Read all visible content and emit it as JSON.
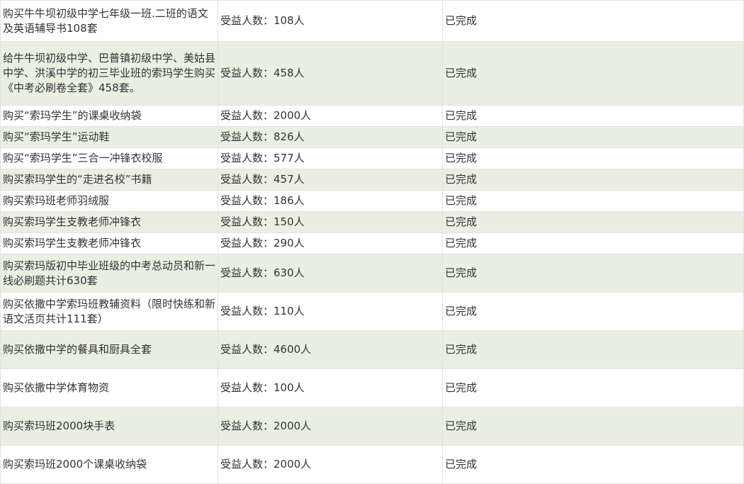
{
  "table": {
    "rows": [
      {
        "item": "购买牛牛坝初级中学七年级一班.二班的语文及英语辅导书108套",
        "beneficiaries": "受益人数：108人",
        "status": "已完成"
      },
      {
        "item": "给牛牛坝初级中学、巴普镇初级中学、美姑县中学、洪溪中学的初三毕业班的索玛学生购买《中考必刷卷全套》458套。",
        "beneficiaries": "受益人数：458人",
        "status": "已完成"
      },
      {
        "item": "购买“索玛学生”的课桌收纳袋",
        "beneficiaries": "受益人数：2000人",
        "status": "已完成"
      },
      {
        "item": "购买“索玛学生”运动鞋",
        "beneficiaries": "受益人数：826人",
        "status": "已完成"
      },
      {
        "item": "购买“索玛学生”三合一冲锋衣校服",
        "beneficiaries": "受益人数：577人",
        "status": "已完成"
      },
      {
        "item": "购买索玛学生的“走进名校”书籍",
        "beneficiaries": "受益人数：457人",
        "status": "已完成"
      },
      {
        "item": "购买索玛班老师羽绒服",
        "beneficiaries": "受益人数：186人",
        "status": "已完成"
      },
      {
        "item": "购买索玛学生支教老师冲锋衣",
        "beneficiaries": "受益人数：150人",
        "status": "已完成"
      },
      {
        "item": "购买索玛学生支教老师冲锋衣",
        "beneficiaries": "受益人数：290人",
        "status": "已完成"
      },
      {
        "item": "购买索玛版初中毕业班级的中考总动员和新一线必刷题共计630套",
        "beneficiaries": "受益人数：630人",
        "status": "已完成"
      },
      {
        "item": "购买依撒中学索玛班教辅资料（限时快练和新语文活页共计111套）",
        "beneficiaries": "受益人数：110人",
        "status": "已完成"
      },
      {
        "item": "购买依撒中学的餐具和厨具全套",
        "beneficiaries": "受益人数：4600人",
        "status": "已完成"
      },
      {
        "item": "购买依撒中学体育物资",
        "beneficiaries": "受益人数：100人",
        "status": "已完成"
      },
      {
        "item": "购买索玛班2000块手表",
        "beneficiaries": "受益人数：2000人",
        "status": "已完成"
      },
      {
        "item": "购买索玛班2000个课桌收纳袋",
        "beneficiaries": "受益人数：2000人",
        "status": "已完成"
      }
    ]
  },
  "colors": {
    "stripe": "#eaefe2",
    "border": "#e2e2e2",
    "text": "#333333"
  }
}
